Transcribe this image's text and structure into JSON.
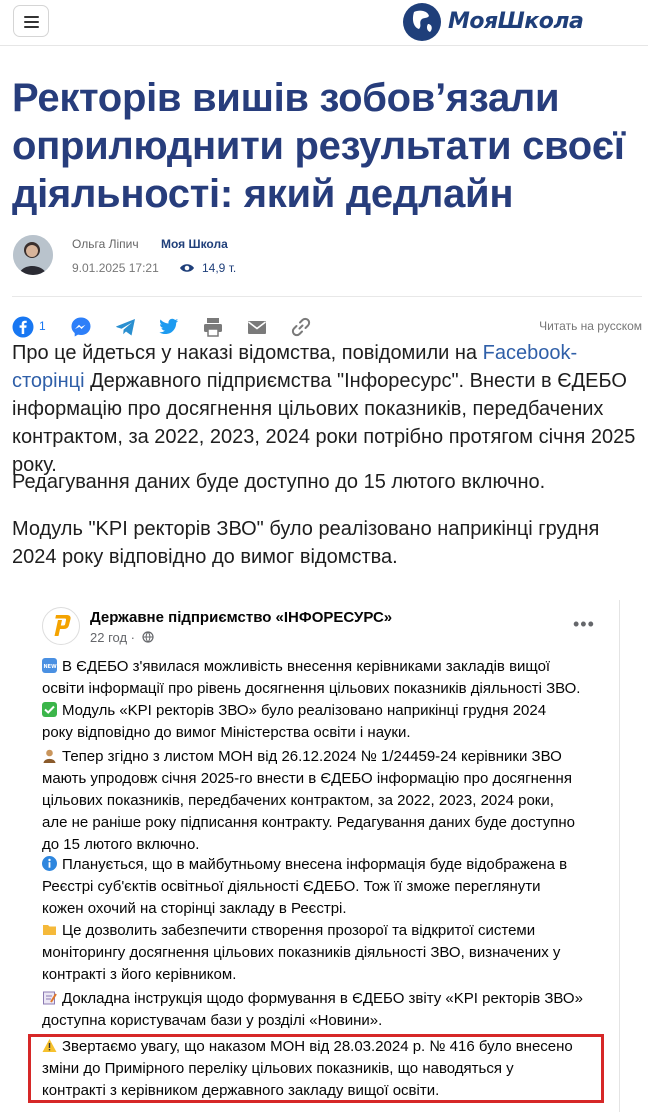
{
  "header": {
    "logo_text": "МояШкола",
    "colors": {
      "brand": "#1f3f7a",
      "link": "#2f5fa8",
      "highlight_border": "#d62828"
    }
  },
  "article": {
    "title_lines": [
      "Ректорів вишів зобов’язали",
      "оприлюднити результати своєї",
      "діяльності: який дедлайн"
    ],
    "author": "Ольга Ліпич",
    "source": "Моя Школа",
    "date": "9.01.2025 17:21",
    "views": "14,9 т.",
    "share": {
      "facebook_count": "1",
      "read_in_russian": "Читать на русском"
    },
    "paragraph1": {
      "before_link": "Про це йдеться у наказі відомства, повідомили на ",
      "link": "Facebook-сторінці",
      "after_link": " Державного підприємства \"Інфоресурс\". Внести в ЄДЕБО інформацію про досягнення цільових показників, передбачених контрактом, за 2022, 2023, 2024 роки потрібно протягом січня 2025 року."
    },
    "paragraph2": "Редагування даних буде доступно до 15 лютого включно.",
    "paragraph3": "Модуль \"KPI ректорів ЗВО\" було реалізовано наприкінці грудня 2024 року відповідно до вимог відомства."
  },
  "embed": {
    "page_name": "Державне підприємство «ІНФОРЕСУРС»",
    "time": "22 год ·",
    "more": "•••",
    "items": [
      {
        "icon": "new-icon",
        "lines": [
          "В ЄДЕБО з'явилася можливість внесення керівниками закладів вищої",
          "освіти інформації про рівень досягнення цільових показників діяльності ЗВО."
        ]
      },
      {
        "icon": "check-icon",
        "lines": [
          "Модуль «KPI ректорів ЗВО» було реалізовано наприкінці грудня 2024",
          "року відповідно до вимог Міністерства освіти і науки."
        ]
      },
      {
        "icon": "person-icon",
        "lines": [
          "Тепер згідно з листом МОН від 26.12.2024 № 1/24459-24 керівники ЗВО",
          "мають упродовж січня 2025-го внести в ЄДЕБО інформацію про досягнення",
          "цільових показників, передбачених контрактом, за 2022, 2023, 2024 роки,",
          "але не раніше року підписання контракту. Редагування даних буде доступно",
          "до 15 лютого включно."
        ]
      },
      {
        "icon": "info-icon",
        "lines": [
          "Планується, що в майбутньому внесена інформація буде відображена в",
          "Реєстрі суб'єктів освітньої діяльності ЄДЕБО. Тож її зможе переглянути",
          "кожен охочий на сторінці закладу в Реєстрі."
        ]
      },
      {
        "icon": "folder-icon",
        "lines": [
          "Це дозволить забезпечити створення прозорої та відкритої системи",
          "моніторингу досягнення цільових показників діяльності ЗВО, визначених у",
          "контракті з його керівником."
        ]
      },
      {
        "icon": "memo-icon",
        "lines": [
          "Докладна інструкція щодо формування в ЄДЕБО звіту «KPI ректорів ЗВО»",
          "доступна користувачам бази у розділі «Новини»."
        ]
      },
      {
        "icon": "warning-icon",
        "lines": [
          "Звертаємо увагу, що наказом МОН від 28.03.2024 р. № 416 було внесено",
          "зміни до Примірного переліку цільових показників, що наводяться у",
          "контракті з керівником державного закладу вищої освіти."
        ]
      }
    ]
  }
}
